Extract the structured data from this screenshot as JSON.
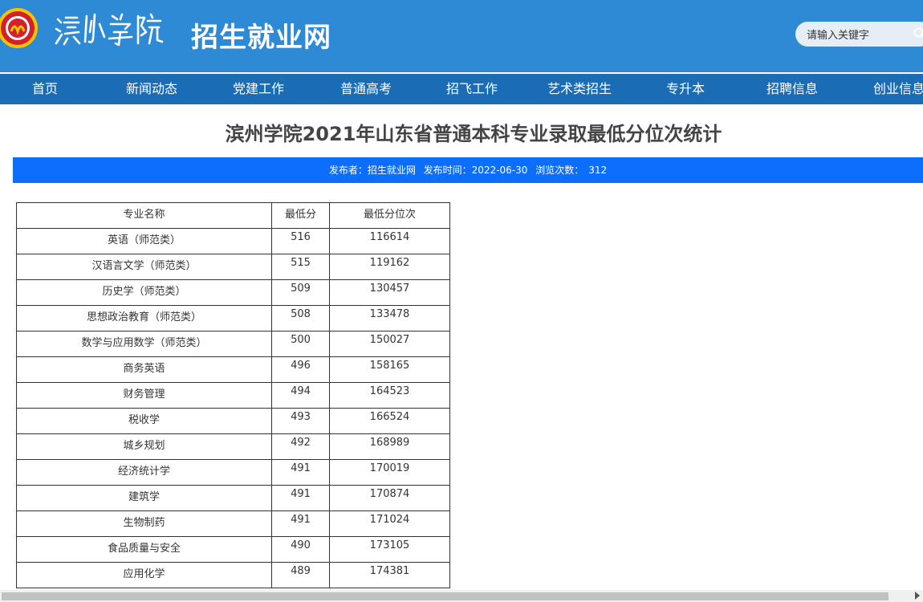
{
  "header": {
    "logo_script_text": "滨州学院",
    "title": "招生就业网",
    "search_placeholder": "请输入关键字"
  },
  "nav": {
    "items": [
      {
        "label": "首页"
      },
      {
        "label": "新闻动态"
      },
      {
        "label": "党建工作"
      },
      {
        "label": "普通高考"
      },
      {
        "label": "招飞工作"
      },
      {
        "label": "艺术类招生"
      },
      {
        "label": "专升本"
      },
      {
        "label": "招聘信息"
      },
      {
        "label": "创业信息"
      }
    ]
  },
  "article": {
    "title": "滨州学院2021年山东省普通本科专业录取最低分位次统计",
    "meta": {
      "publisher": "发布者：招生就业网",
      "date": "发布时间：2022-06-30",
      "views_label": "浏览次数：",
      "views": "312"
    }
  },
  "table": {
    "headers": [
      "专业名称",
      "最低分",
      "最低分位次"
    ],
    "rows": [
      {
        "name": "英语（师范类）",
        "score": "516",
        "rank": "116614"
      },
      {
        "name": "汉语言文学（师范类）",
        "score": "515",
        "rank": "119162"
      },
      {
        "name": "历史学（师范类）",
        "score": "509",
        "rank": "130457"
      },
      {
        "name": "思想政治教育（师范类）",
        "score": "508",
        "rank": "133478"
      },
      {
        "name": "数学与应用数学（师范类）",
        "score": "500",
        "rank": "150027"
      },
      {
        "name": "商务英语",
        "score": "496",
        "rank": "158165"
      },
      {
        "name": "财务管理",
        "score": "494",
        "rank": "164523"
      },
      {
        "name": "税收学",
        "score": "493",
        "rank": "166524"
      },
      {
        "name": "城乡规划",
        "score": "492",
        "rank": "168989"
      },
      {
        "name": "经济统计学",
        "score": "491",
        "rank": "170019"
      },
      {
        "name": "建筑学",
        "score": "491",
        "rank": "170874"
      },
      {
        "name": "生物制药",
        "score": "491",
        "rank": "171024"
      },
      {
        "name": "食品质量与安全",
        "score": "490",
        "rank": "173105"
      },
      {
        "name": "应用化学",
        "score": "489",
        "rank": "174381"
      }
    ]
  },
  "colors": {
    "header_bg": "#2f8ad6",
    "nav_bg": "#1a6cb5",
    "meta_bar_bg": "#0d6efd"
  },
  "icons": {
    "emblem": "university-emblem-icon",
    "search": "search-icon"
  }
}
